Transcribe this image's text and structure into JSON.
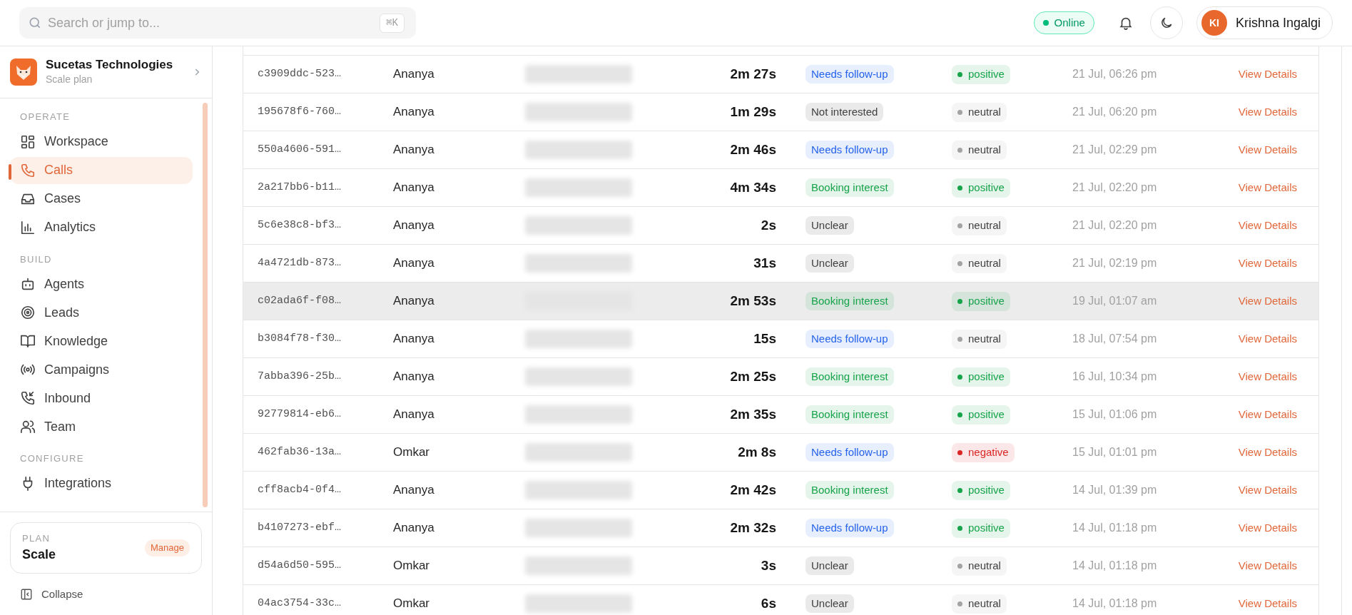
{
  "search": {
    "placeholder": "Search or jump to...",
    "shortcut": "⌘K"
  },
  "header": {
    "status": "Online",
    "user": {
      "initials": "KI",
      "name": "Krishna Ingalgi"
    }
  },
  "organization": {
    "name": "Sucetas Technologies",
    "plan": "Scale plan"
  },
  "sidebar": {
    "sections": [
      {
        "title": "OPERATE",
        "items": [
          {
            "label": "Workspace",
            "selected": false
          },
          {
            "label": "Calls",
            "selected": true
          },
          {
            "label": "Cases",
            "selected": false
          },
          {
            "label": "Analytics",
            "selected": false
          }
        ]
      },
      {
        "title": "BUILD",
        "items": [
          {
            "label": "Agents",
            "selected": false
          },
          {
            "label": "Leads",
            "selected": false
          },
          {
            "label": "Knowledge",
            "selected": false
          },
          {
            "label": "Campaigns",
            "selected": false
          },
          {
            "label": "Inbound",
            "selected": false
          },
          {
            "label": "Team",
            "selected": false
          }
        ]
      },
      {
        "title": "CONFIGURE",
        "items": [
          {
            "label": "Integrations",
            "selected": false
          }
        ]
      }
    ],
    "plan": {
      "caption": "PLAN",
      "name": "Scale",
      "action": "Manage"
    },
    "collapse": "Collapse"
  },
  "table": {
    "rows": [
      {
        "id": "c3909ddc-523…",
        "agent": "Ananya",
        "duration": "2m 27s",
        "outcome": {
          "label": "Needs follow-up",
          "color": "#2563eb"
        },
        "sentiment": {
          "label": "positive",
          "color": "#16a34a"
        },
        "date": "21 Jul, 06:26 pm",
        "action": "View Details",
        "selected": false
      },
      {
        "id": "195678f6-760…",
        "agent": "Ananya",
        "duration": "1m 29s",
        "outcome": {
          "label": "Not interested",
          "color": "#404040"
        },
        "sentiment": {
          "label": "neutral",
          "color": "#a3a3a3"
        },
        "date": "21 Jul, 06:20 pm",
        "action": "View Details",
        "selected": false
      },
      {
        "id": "550a4606-591…",
        "agent": "Ananya",
        "duration": "2m 46s",
        "outcome": {
          "label": "Needs follow-up",
          "color": "#2563eb"
        },
        "sentiment": {
          "label": "neutral",
          "color": "#a3a3a3"
        },
        "date": "21 Jul, 02:29 pm",
        "action": "View Details",
        "selected": false
      },
      {
        "id": "2a217bb6-b11…",
        "agent": "Ananya",
        "duration": "4m 34s",
        "outcome": {
          "label": "Booking interest",
          "color": "#16a34a"
        },
        "sentiment": {
          "label": "positive",
          "color": "#16a34a"
        },
        "date": "21 Jul, 02:20 pm",
        "action": "View Details",
        "selected": false
      },
      {
        "id": "5c6e38c8-bf3…",
        "agent": "Ananya",
        "duration": "2s",
        "outcome": {
          "label": "Unclear",
          "color": "#404040"
        },
        "sentiment": {
          "label": "neutral",
          "color": "#a3a3a3"
        },
        "date": "21 Jul, 02:20 pm",
        "action": "View Details",
        "selected": false
      },
      {
        "id": "4a4721db-873…",
        "agent": "Ananya",
        "duration": "31s",
        "outcome": {
          "label": "Unclear",
          "color": "#404040"
        },
        "sentiment": {
          "label": "neutral",
          "color": "#a3a3a3"
        },
        "date": "21 Jul, 02:19 pm",
        "action": "View Details",
        "selected": false
      },
      {
        "id": "c02ada6f-f08…",
        "agent": "Ananya",
        "duration": "2m 53s",
        "outcome": {
          "label": "Booking interest",
          "color": "#16a34a"
        },
        "sentiment": {
          "label": "positive",
          "color": "#16a34a"
        },
        "date": "19 Jul, 01:07 am",
        "action": "View Details",
        "selected": true
      },
      {
        "id": "b3084f78-f30…",
        "agent": "Ananya",
        "duration": "15s",
        "outcome": {
          "label": "Needs follow-up",
          "color": "#2563eb"
        },
        "sentiment": {
          "label": "neutral",
          "color": "#a3a3a3"
        },
        "date": "18 Jul, 07:54 pm",
        "action": "View Details",
        "selected": false
      },
      {
        "id": "7abba396-25b…",
        "agent": "Ananya",
        "duration": "2m 25s",
        "outcome": {
          "label": "Booking interest",
          "color": "#16a34a"
        },
        "sentiment": {
          "label": "positive",
          "color": "#16a34a"
        },
        "date": "16 Jul, 10:34 pm",
        "action": "View Details",
        "selected": false
      },
      {
        "id": "92779814-eb6…",
        "agent": "Ananya",
        "duration": "2m 35s",
        "outcome": {
          "label": "Booking interest",
          "color": "#16a34a"
        },
        "sentiment": {
          "label": "positive",
          "color": "#16a34a"
        },
        "date": "15 Jul, 01:06 pm",
        "action": "View Details",
        "selected": false
      },
      {
        "id": "462fab36-13a…",
        "agent": "Omkar",
        "duration": "2m 8s",
        "outcome": {
          "label": "Needs follow-up",
          "color": "#2563eb"
        },
        "sentiment": {
          "label": "negative",
          "color": "#dc2626"
        },
        "date": "15 Jul, 01:01 pm",
        "action": "View Details",
        "selected": false
      },
      {
        "id": "cff8acb4-0f4…",
        "agent": "Ananya",
        "duration": "2m 42s",
        "outcome": {
          "label": "Booking interest",
          "color": "#16a34a"
        },
        "sentiment": {
          "label": "positive",
          "color": "#16a34a"
        },
        "date": "14 Jul, 01:39 pm",
        "action": "View Details",
        "selected": false
      },
      {
        "id": "b4107273-ebf…",
        "agent": "Ananya",
        "duration": "2m 32s",
        "outcome": {
          "label": "Needs follow-up",
          "color": "#2563eb"
        },
        "sentiment": {
          "label": "positive",
          "color": "#16a34a"
        },
        "date": "14 Jul, 01:18 pm",
        "action": "View Details",
        "selected": false
      },
      {
        "id": "d54a6d50-595…",
        "agent": "Omkar",
        "duration": "3s",
        "outcome": {
          "label": "Unclear",
          "color": "#404040"
        },
        "sentiment": {
          "label": "neutral",
          "color": "#a3a3a3"
        },
        "date": "14 Jul, 01:18 pm",
        "action": "View Details",
        "selected": false
      },
      {
        "id": "04ac3754-33c…",
        "agent": "Omkar",
        "duration": "6s",
        "outcome": {
          "label": "Unclear",
          "color": "#404040"
        },
        "sentiment": {
          "label": "neutral",
          "color": "#a3a3a3"
        },
        "date": "14 Jul, 01:18 pm",
        "action": "View Details",
        "selected": false
      }
    ]
  }
}
